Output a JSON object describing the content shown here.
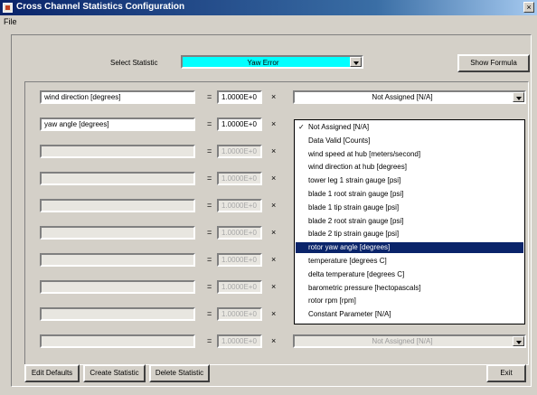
{
  "window": {
    "title": "Cross Channel Statistics Configuration",
    "close_label": "×"
  },
  "menu": {
    "file": "File"
  },
  "select_statistic": {
    "label": "Select Statistic",
    "value": "Yaw Error"
  },
  "show_formula_label": "Show Formula",
  "equals": "=",
  "operator": "×",
  "rows": [
    {
      "variable": "wind direction  [degrees]",
      "coefficient": "1.0000E+0",
      "assigned": "Not Assigned  [N/A]"
    },
    {
      "variable": "yaw angle  [degrees]",
      "coefficient": "1.0000E+0",
      "assigned": ""
    },
    {
      "variable": "",
      "coefficient": "1.0000E+0",
      "assigned": ""
    },
    {
      "variable": "",
      "coefficient": "1.0000E+0",
      "assigned": ""
    },
    {
      "variable": "",
      "coefficient": "1.0000E+0",
      "assigned": ""
    },
    {
      "variable": "",
      "coefficient": "1.0000E+0",
      "assigned": ""
    },
    {
      "variable": "",
      "coefficient": "1.0000E+0",
      "assigned": ""
    },
    {
      "variable": "",
      "coefficient": "1.0000E+0",
      "assigned": ""
    },
    {
      "variable": "",
      "coefficient": "1.0000E+0",
      "assigned": ""
    },
    {
      "variable": "",
      "coefficient": "1.0000E+0",
      "assigned": "Not Assigned  [N/A]"
    }
  ],
  "dropdown": {
    "check_mark": "✓",
    "items": [
      "Not Assigned  [N/A]",
      "Data Valid  [Counts]",
      "wind speed at hub  [meters/second]",
      "wind direction at hub  [degrees]",
      "tower leg 1 strain gauge  [psi]",
      "blade 1 root strain gauge  [psi]",
      "blade 1 tip strain gauge  [psi]",
      "blade 2 root strain gauge  [psi]",
      "blade 2 tip strain gauge  [psi]",
      "rotor yaw angle  [degrees]",
      "temperature  [degrees C]",
      "delta temperature  [degrees C]",
      "barometric pressure  [hectopascals]",
      "rotor rpm  [rpm]",
      "Constant Parameter  [N/A]"
    ],
    "checked_index": 0,
    "selected_index": 9
  },
  "buttons": {
    "edit_defaults": "Edit Defaults",
    "create_statistic": "Create Statistic",
    "delete_statistic": "Delete Statistic",
    "exit": "Exit"
  }
}
